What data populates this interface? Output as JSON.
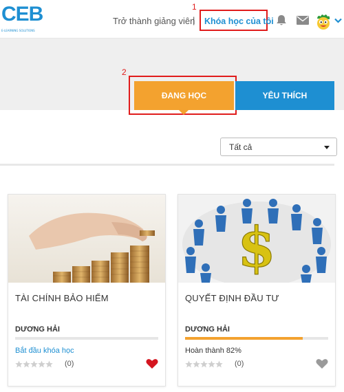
{
  "header": {
    "logo_text": "CEB",
    "logo_sub": "E-LEARNING SOLUTIONS",
    "become_teacher": "Trở thành giảng viên",
    "separator": "|",
    "my_courses": "Khóa học của tôi",
    "icons": [
      "bell-icon",
      "mail-icon",
      "avatar",
      "chevron-down-icon"
    ],
    "accent_color": "#1e8fd2"
  },
  "annotations": {
    "first": "1",
    "second": "2",
    "highlight_color": "#e01b1b"
  },
  "tabs": {
    "learning": "ĐANG HỌC",
    "favorite": "YÊU THÍCH",
    "learning_color": "#f3a22f",
    "favorite_color": "#1e8fd2"
  },
  "filter": {
    "selected": "Tất cả"
  },
  "courses": [
    {
      "title": "TÀI CHÍNH BẢO HIỂM",
      "author": "DƯƠNG HẢI",
      "status": "Bắt đầu khóa học",
      "progress": 0,
      "rating_count": "(0)",
      "favorite": true,
      "image": "coins-stack-image"
    },
    {
      "title": "QUYẾT ĐỊNH ĐẦU TƯ",
      "author": "DƯƠNG HẢI",
      "status": "Hoàn thành 82%",
      "progress": 0.82,
      "rating_count": "(0)",
      "favorite": false,
      "image": "dollar-figures-image"
    }
  ]
}
